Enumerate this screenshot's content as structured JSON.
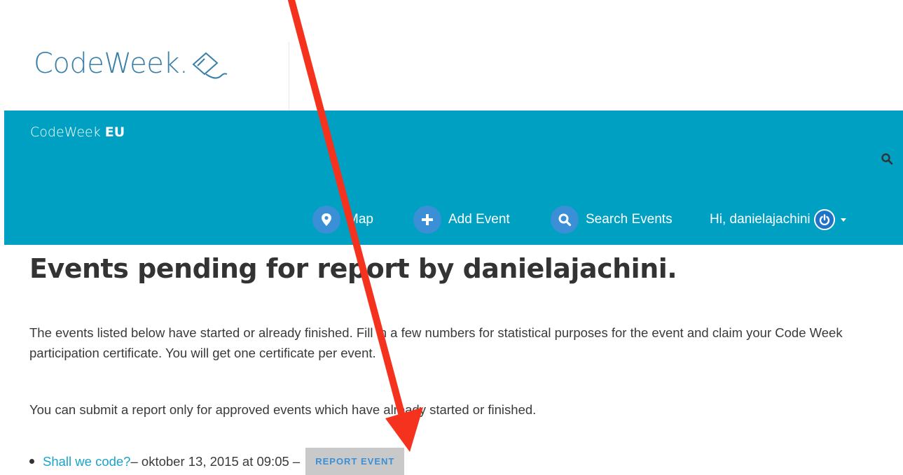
{
  "logo": {
    "text": "CodeWeek."
  },
  "navbar": {
    "brand_prefix": "CodeWeek ",
    "brand_bold": "EU",
    "menu": {
      "map": "Map",
      "add_event": "Add Event",
      "search_events": "Search Events",
      "user": "Hi, danielajachini"
    }
  },
  "page": {
    "title": "Events pending for report by danielajachini.",
    "intro": "The events listed below have started or already finished. Fill in a few numbers for statistical purposes for the event and claim your Code Week participation certificate. You will get one certificate per event.",
    "note": "You can submit a report only for approved events which have already started or finished."
  },
  "events": [
    {
      "title": "Shall we code?",
      "meta": " – oktober 13, 2015 at 09:05 – ",
      "action": "REPORT EVENT"
    }
  ],
  "colors": {
    "navbar": "#00a0c2",
    "menu_circle": "#3b8fd6",
    "annotation_arrow": "#f4321e",
    "link": "#1aa3c8"
  }
}
